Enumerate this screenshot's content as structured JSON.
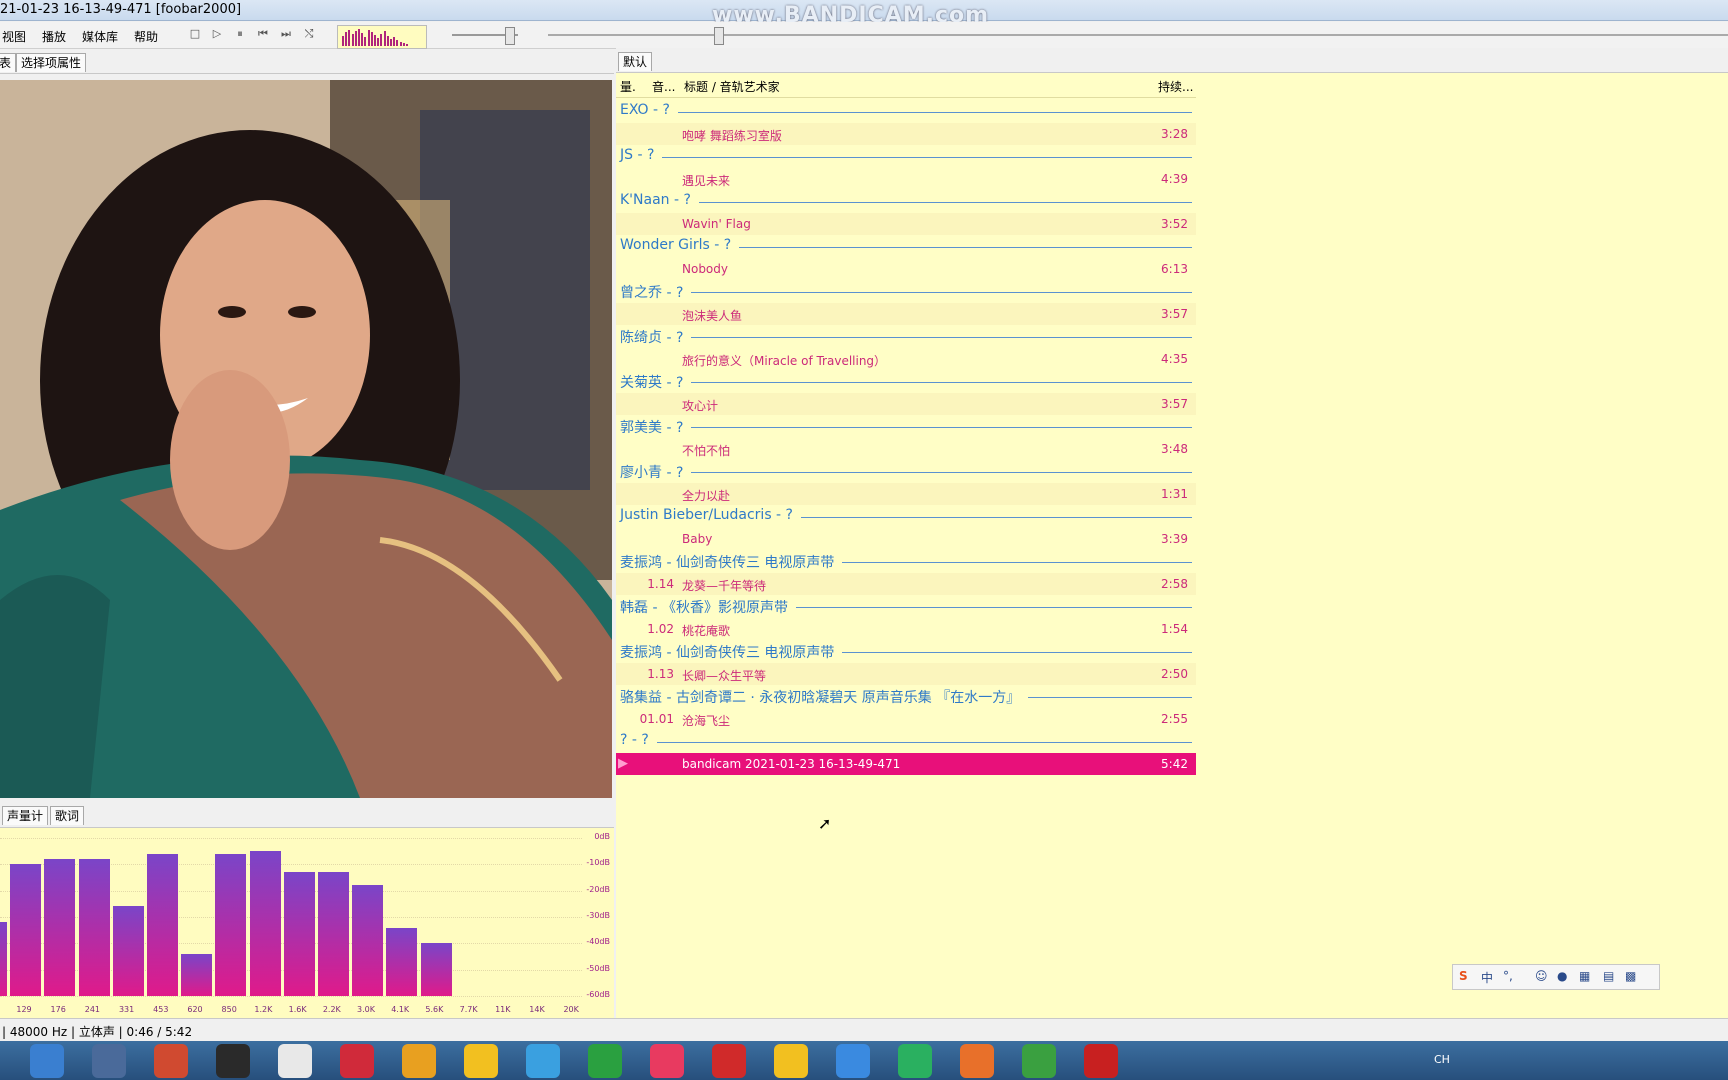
{
  "window": {
    "title": "21-01-23 16-13-49-471  [foobar2000]",
    "watermark": "www.BANDICAM.com"
  },
  "menu": [
    "视图",
    "播放",
    "媒体库",
    "帮助"
  ],
  "toolbar": {
    "icons": [
      "stop-icon",
      "play-icon",
      "pause-icon",
      "previous-icon",
      "next-icon",
      "random-icon"
    ]
  },
  "left_tabs": [
    "表",
    "选择项属性"
  ],
  "viz_tabs": [
    "声量计",
    "歌词"
  ],
  "viz": {
    "db_labels": [
      "0dB",
      "-10dB",
      "-20dB",
      "-30dB",
      "-40dB",
      "-50dB",
      "-60dB"
    ],
    "freq_labels": [
      "129",
      "176",
      "241",
      "331",
      "453",
      "620",
      "850",
      "1.2K",
      "1.6K",
      "2.2K",
      "3.0K",
      "4.1K",
      "5.6K",
      "7.7K",
      "11K",
      "14K",
      "20K"
    ],
    "levels_db": [
      -32,
      -10,
      -8,
      -8,
      -26,
      -6,
      -44,
      -6,
      -5,
      -13,
      -13,
      -18,
      -34,
      -40,
      -60,
      -60,
      -60,
      -60
    ]
  },
  "playlist_tab": "默认",
  "columns": {
    "c1": "量.",
    "c2": "音...",
    "c3": "标题 / 音轨艺术家",
    "c4": "持续..."
  },
  "groups": [
    {
      "header": "EXO - ?",
      "tracks": [
        {
          "num": "",
          "title": "咆哮 舞蹈练习室版",
          "dur": "3:28"
        }
      ]
    },
    {
      "header": "JS - ?",
      "tracks": [
        {
          "num": "",
          "title": "遇见未来",
          "dur": "4:39"
        }
      ]
    },
    {
      "header": "K'Naan - ?",
      "tracks": [
        {
          "num": "",
          "title": "Wavin' Flag",
          "dur": "3:52"
        }
      ]
    },
    {
      "header": "Wonder Girls - ?",
      "tracks": [
        {
          "num": "",
          "title": "Nobody",
          "dur": "6:13"
        }
      ]
    },
    {
      "header": "曾之乔 - ?",
      "tracks": [
        {
          "num": "",
          "title": "泡沫美人鱼",
          "dur": "3:57"
        }
      ]
    },
    {
      "header": "陈绮贞 - ?",
      "tracks": [
        {
          "num": "",
          "title": "旅行的意义（Miracle of Travelling）",
          "dur": "4:35"
        }
      ]
    },
    {
      "header": "关菊英 - ?",
      "tracks": [
        {
          "num": "",
          "title": "攻心计",
          "dur": "3:57"
        }
      ]
    },
    {
      "header": "郭美美 - ?",
      "tracks": [
        {
          "num": "",
          "title": "不怕不怕",
          "dur": "3:48"
        }
      ]
    },
    {
      "header": "廖小青 - ?",
      "tracks": [
        {
          "num": "",
          "title": "全力以赴",
          "dur": "1:31"
        }
      ]
    },
    {
      "header": "Justin Bieber/Ludacris - ?",
      "tracks": [
        {
          "num": "",
          "title": "Baby",
          "dur": "3:39"
        }
      ]
    },
    {
      "header": "麦振鸿 - 仙剑奇侠传三 电视原声带",
      "tracks": [
        {
          "num": "1.14",
          "title": "龙葵—千年等待",
          "dur": "2:58"
        }
      ]
    },
    {
      "header": "韩磊 - 《秋香》影视原声带",
      "tracks": [
        {
          "num": "1.02",
          "title": "桃花庵歌",
          "dur": "1:54"
        }
      ]
    },
    {
      "header": "麦振鸿 - 仙剑奇侠传三 电视原声带",
      "tracks": [
        {
          "num": "1.13",
          "title": "长卿—众生平等",
          "dur": "2:50"
        }
      ]
    },
    {
      "header": "骆集益 - 古剑奇谭二 · 永夜初晗凝碧天 原声音乐集 『在水一方』",
      "tracks": [
        {
          "num": "01.01",
          "title": "沧海飞尘",
          "dur": "2:55"
        }
      ]
    },
    {
      "header": "? - ?",
      "tracks": [
        {
          "num": "",
          "title": "bandicam 2021-01-23 16-13-49-471",
          "dur": "5:42",
          "now_playing": true
        }
      ]
    }
  ],
  "status": "| 48000 Hz | 立体声 | 0:46 / 5:42",
  "ime": {
    "labels": [
      "中",
      "°,"
    ]
  },
  "taskbar": {
    "apps": [
      "search-icon",
      "file-explorer-icon",
      "media-player-icon",
      "headphones-icon",
      "foobar-icon",
      "netease-music-icon",
      "chrome-like-icon",
      "potplayer-icon",
      "app-1-icon",
      "iqiyi-icon",
      "youku-icon",
      "flash-icon",
      "chrome-icon",
      "feishu-icon",
      "tencent-video-icon",
      "firefox-icon",
      "ie-icon",
      "bandicam-icon"
    ],
    "tray_label": "CH"
  },
  "colors": {
    "group": "#2f7ac8",
    "track": "#cc2a7a",
    "now_playing": "#e8107a",
    "background": "#fffec6"
  }
}
